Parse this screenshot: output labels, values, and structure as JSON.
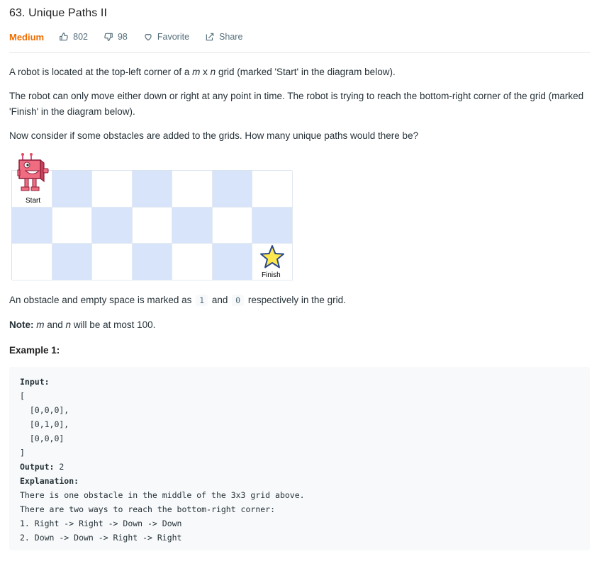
{
  "problem": {
    "title": "63. Unique Paths II",
    "difficulty": "Medium",
    "likes": "802",
    "dislikes": "98",
    "favorite_label": "Favorite",
    "share_label": "Share"
  },
  "description": {
    "p1_prefix": "A robot is located at the top-left corner of a ",
    "p1_m": "m",
    "p1_x": " x ",
    "p1_n": "n",
    "p1_suffix": " grid (marked 'Start' in the diagram below).",
    "p2": "The robot can only move either down or right at any point in time. The robot is trying to reach the bottom-right corner of the grid (marked 'Finish' in the diagram below).",
    "p3": "Now consider if some obstacles are added to the grids. How many unique paths would there be?",
    "p4_prefix": "An obstacle and empty space is marked as",
    "p4_one": "1",
    "p4_and": "and",
    "p4_zero": "0",
    "p4_suffix": "respectively in the grid.",
    "note_label": "Note:",
    "note_m": "m",
    "note_and": " and ",
    "note_n": "n",
    "note_suffix": " will be at most 100.",
    "example_heading": "Example 1:"
  },
  "diagram": {
    "start_label": "Start",
    "finish_label": "Finish",
    "rows": 3,
    "cols": 7,
    "pattern": [
      [
        "white",
        "blue",
        "white",
        "blue",
        "white",
        "blue",
        "white"
      ],
      [
        "blue",
        "white",
        "blue",
        "white",
        "blue",
        "white",
        "blue"
      ],
      [
        "white",
        "blue",
        "white",
        "blue",
        "white",
        "blue",
        "white"
      ]
    ],
    "colors": {
      "blue_cell": "#d7e4fa",
      "robot": "#e84a5f",
      "star": "#ffe84d"
    }
  },
  "example": {
    "input_label": "Input:",
    "lines_input": [
      "[",
      "  [0,0,0],",
      "  [0,1,0],",
      "  [0,0,0]",
      "]"
    ],
    "output_label": "Output:",
    "output_value": " 2",
    "explanation_label": "Explanation:",
    "explanation_lines": [
      "There is one obstacle in the middle of the 3x3 grid above.",
      "There are two ways to reach the bottom-right corner:",
      "1. Right -> Right -> Down -> Down",
      "2. Down -> Down -> Right -> Right"
    ]
  },
  "colors": {
    "difficulty_medium": "#ef6c00",
    "text": "#263238",
    "muted": "#546e7a",
    "code_bg": "#f7f9fa"
  }
}
